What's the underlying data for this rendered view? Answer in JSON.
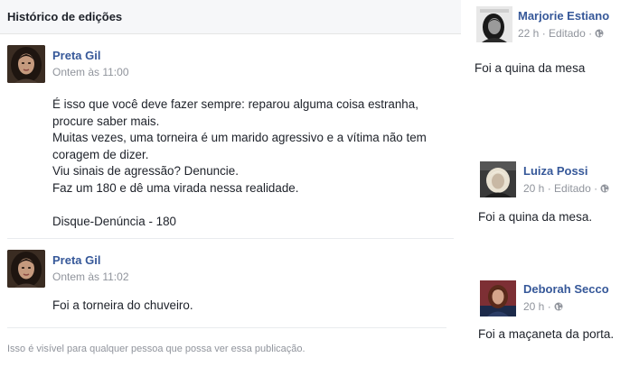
{
  "history": {
    "title": "Histórico de edições",
    "entries": [
      {
        "author": "Preta Gil",
        "time": "Ontem às 11:00",
        "paragraph1": [
          "É isso que você deve fazer sempre: reparou alguma coisa estranha,",
          "procure saber mais.",
          "Muitas vezes, uma torneira é um marido agressivo e a vítima não tem",
          "coragem de dizer.",
          "Viu sinais de agressão? Denuncie.",
          "Faz um 180 e dê uma virada nessa realidade."
        ],
        "paragraph2": "Disque-Denúncia - 180"
      },
      {
        "author": "Preta Gil",
        "time": "Ontem às 11:02",
        "text": "Foi a torneira do chuveiro."
      }
    ],
    "visibility_note": "Isso é visível para qualquer pessoa que possa ver essa publicação."
  },
  "comments": [
    {
      "name": "Marjorie Estiano",
      "time": "22 h",
      "edited": "Editado",
      "separator": "·",
      "text": "Foi a quina da mesa"
    },
    {
      "name": "Luiza Possi",
      "time": "20 h",
      "edited": "Editado",
      "separator": "·",
      "text": "Foi a quina da mesa."
    },
    {
      "name": "Deborah Secco",
      "time": "20 h",
      "separator": "·",
      "text": "Foi a maçaneta da porta."
    }
  ],
  "colors": {
    "link": "#365899",
    "meta": "#90949c",
    "text": "#1d2129",
    "header_bg": "#f6f7f9"
  },
  "icons": {
    "privacy": "globe-icon"
  }
}
